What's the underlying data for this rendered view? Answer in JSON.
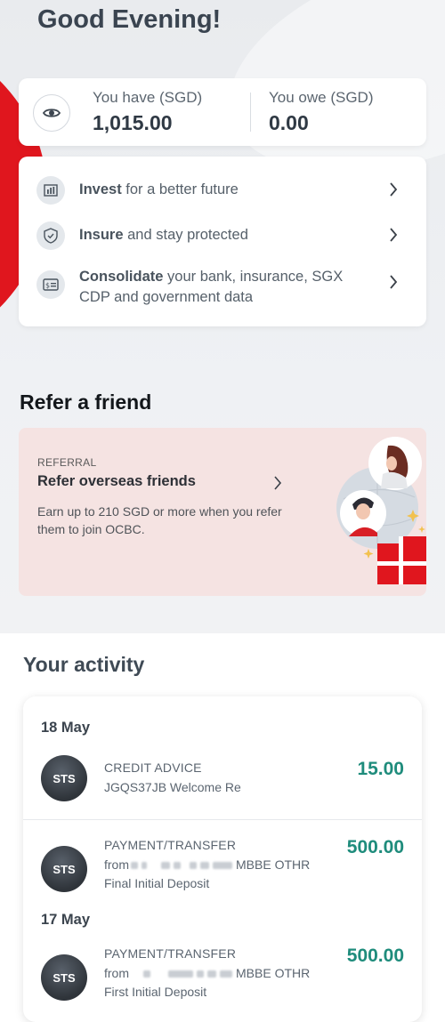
{
  "greeting": "Good Evening!",
  "balances": {
    "have_label": "You have (SGD)",
    "have_value": "1,015.00",
    "owe_label": "You owe (SGD)",
    "owe_value": "0.00"
  },
  "actions": [
    {
      "bold": "Invest",
      "rest": " for a better future",
      "icon": "bar-chart-icon"
    },
    {
      "bold": "Insure",
      "rest": " and stay protected",
      "icon": "shield-check-icon"
    },
    {
      "bold": "Consolidate",
      "rest": " your bank, insurance, SGX CDP and government data",
      "icon": "consolidate-icon"
    }
  ],
  "refer": {
    "section_title": "Refer a friend",
    "tag": "REFERRAL",
    "heading": "Refer overseas friends",
    "description": "Earn up to 210 SGD or more when you refer them to join OCBC."
  },
  "activity": {
    "title": "Your activity",
    "groups": [
      {
        "date": "18 May",
        "transactions": [
          {
            "avatar": "STS",
            "type": "CREDIT ADVICE",
            "line2": "JGQS37JB Welcome Re",
            "line3": "",
            "amount": "15.00"
          },
          {
            "avatar": "STS",
            "type": "PAYMENT/TRANSFER",
            "line2_prefix": "from",
            "line2_suffix": "MBBE OTHR",
            "line3": "Final Initial Deposit",
            "amount": "500.00"
          }
        ]
      },
      {
        "date": "17 May",
        "transactions": [
          {
            "avatar": "STS",
            "type": "PAYMENT/TRANSFER",
            "line2_prefix": "from",
            "line2_suffix": "MBBE OTHR",
            "line3": "First Initial Deposit",
            "amount": "500.00"
          }
        ]
      }
    ]
  },
  "colors": {
    "accent_red": "#e0161e",
    "amount_green": "#1f8c7c",
    "card_bg": "#ffffff"
  }
}
